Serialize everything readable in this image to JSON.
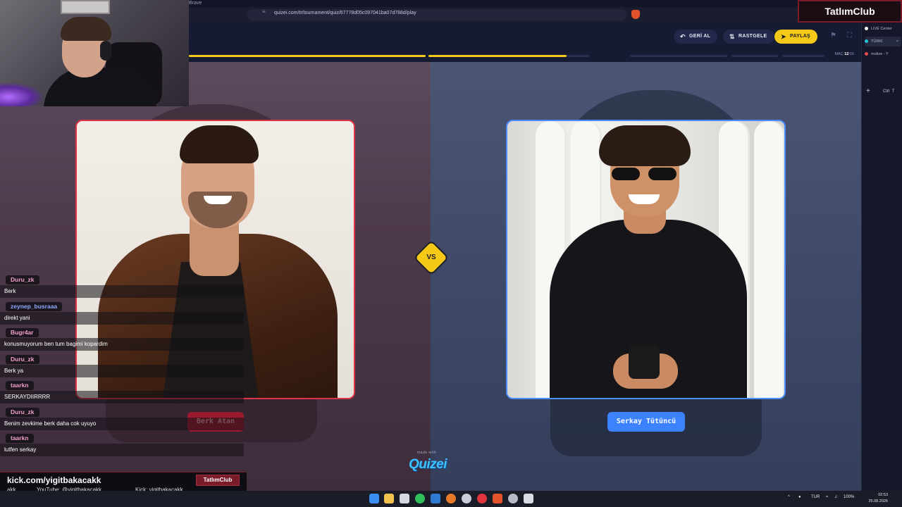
{
  "browser": {
    "app_name": "Brave",
    "url": "quizei.com/tr/tournament/quiz/67778d05c097041ba07d788d/play"
  },
  "side_panel": {
    "items": [
      {
        "label": "LIVE Center",
        "color": "#ffffff"
      },
      {
        "label": "TÜRKİ",
        "color": "#22c3d6",
        "active": true,
        "close": "×"
      },
      {
        "label": "motive - Y",
        "color": "#e14b4b"
      }
    ],
    "plus": "+",
    "ctrl_label": "Ctrl",
    "t_label": "T"
  },
  "streamer_brand": "TatlımClub",
  "header": {
    "back_label": "GERİ AL",
    "random_label": "RASTGELE",
    "share_label": "PAYLAŞ",
    "back_icon": "undo-icon",
    "random_icon": "shuffle-icon",
    "share_icon": "send-icon",
    "flag_icon": "flag-icon",
    "fullscreen_icon": "fullscreen-icon",
    "match_label": "MAÇ",
    "match_current": "12",
    "match_total": "/16",
    "progress_segments": [
      1.0,
      0.86,
      0,
      0,
      0
    ]
  },
  "match": {
    "left_name": "Berk Atan",
    "right_name": "Serkay Tütüncü",
    "vs_label": "VS",
    "left_color": "#e03348",
    "right_color": "#4a8cff",
    "accent": "#f4c918"
  },
  "branding": {
    "made_with": "made with",
    "logo": "Quizei"
  },
  "chat": {
    "messages": [
      {
        "user": "Duru_zk",
        "user_color": "#f2a0c8",
        "text": "Berk"
      },
      {
        "user": "zeynep_busraaa",
        "user_color": "#8ea8ff",
        "text": "direkt yani"
      },
      {
        "user": "Bugr4ar",
        "user_color": "#f2a0c8",
        "text": "konusmuyorum ben tum bagimi kopardim"
      },
      {
        "user": "Duru_zk",
        "user_color": "#f2a0c8",
        "text": "Berk ya"
      },
      {
        "user": "taarkn",
        "user_color": "#f2a0c8",
        "text": "SERKAYDIIRRRR"
      },
      {
        "user": "Duru_zk",
        "user_color": "#f2a0c8",
        "text": "Benim zevkime berk daha cok uyuyo"
      },
      {
        "user": "taarkn",
        "user_color": "#f2a0c8",
        "text": "lutfen serkay"
      }
    ]
  },
  "footer": {
    "kick_url": "kick.com/yigitbakacakk",
    "badge": "TatlımClub",
    "ticker": [
      "akk",
      "YouTube: @yigitbakacakk",
      "Kick: yigitbakacakk"
    ]
  },
  "taskbar": {
    "language": "TUR",
    "battery": "100%",
    "time": "02:53",
    "date": "25.08.2026",
    "caret": "^"
  }
}
